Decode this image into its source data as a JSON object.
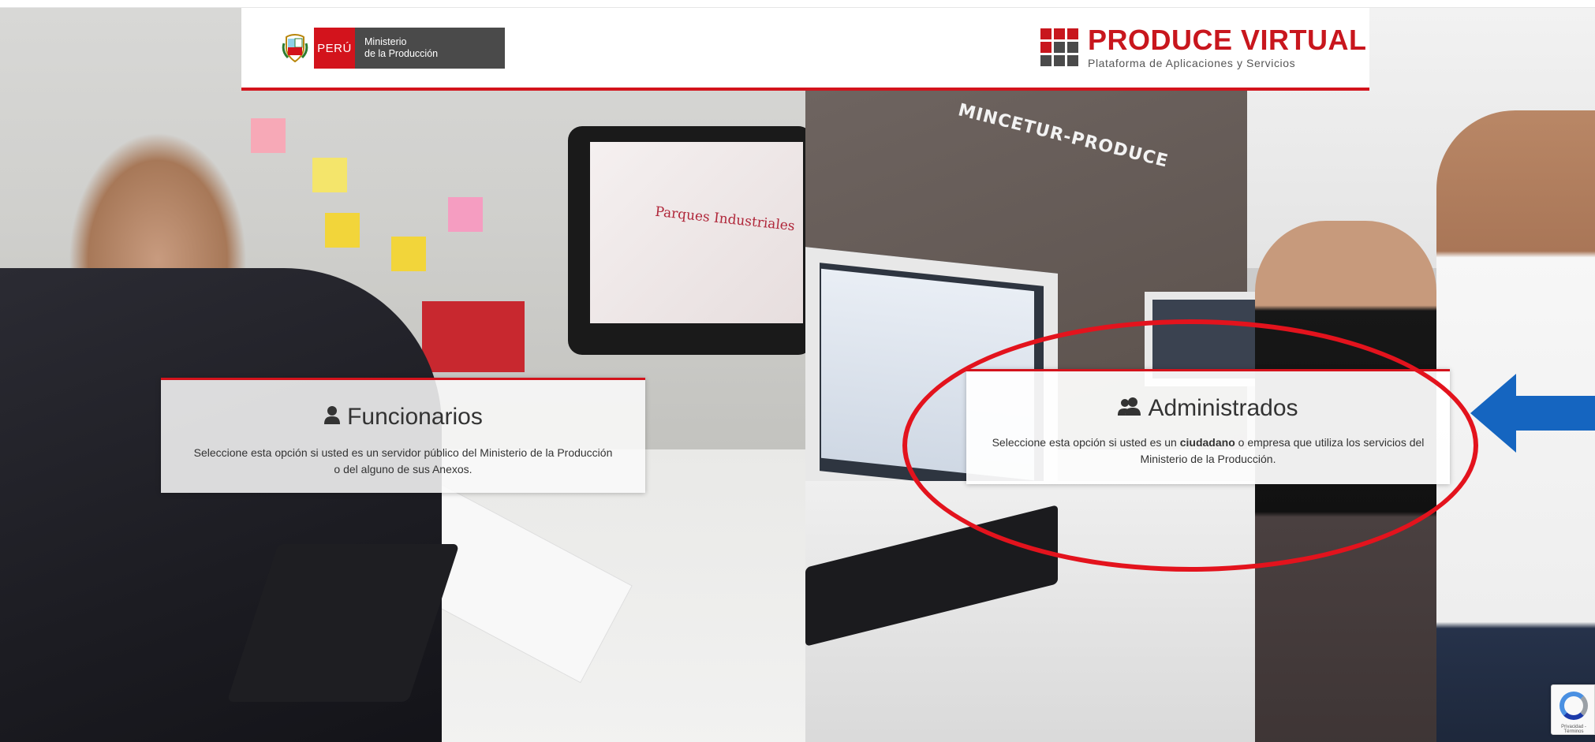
{
  "header": {
    "gov_logo": {
      "country": "PERÚ",
      "ministry_line1": "Ministerio",
      "ministry_line2": "de la Producción"
    },
    "brand": {
      "title": "PRODUCE VIRTUAL",
      "subtitle": "Plataforma de Aplicaciones y Servicios"
    }
  },
  "background": {
    "left_monitor_text": "Parques Industriales",
    "right_wall_text": "MINCETUR-PRODUCE"
  },
  "options": [
    {
      "id": "funcionarios",
      "icon": "user-icon",
      "title": "Funcionarios",
      "description": "Seleccione esta opción si usted es un servidor público del Ministerio de la Producción o del alguno de sus Anexos."
    },
    {
      "id": "administrados",
      "icon": "users-icon",
      "title": "Administrados",
      "description_before": "Seleccione esta opción si usted es un ",
      "description_bold": "ciudadano",
      "description_after": " o empresa que utiliza los servicios del Ministerio de la Producción."
    }
  ],
  "annotations": {
    "highlight_color": "#e3131d",
    "arrow_color": "#1565c0"
  },
  "colors": {
    "accent_red": "#d3131c",
    "dark_gray": "#4a4a4a"
  }
}
